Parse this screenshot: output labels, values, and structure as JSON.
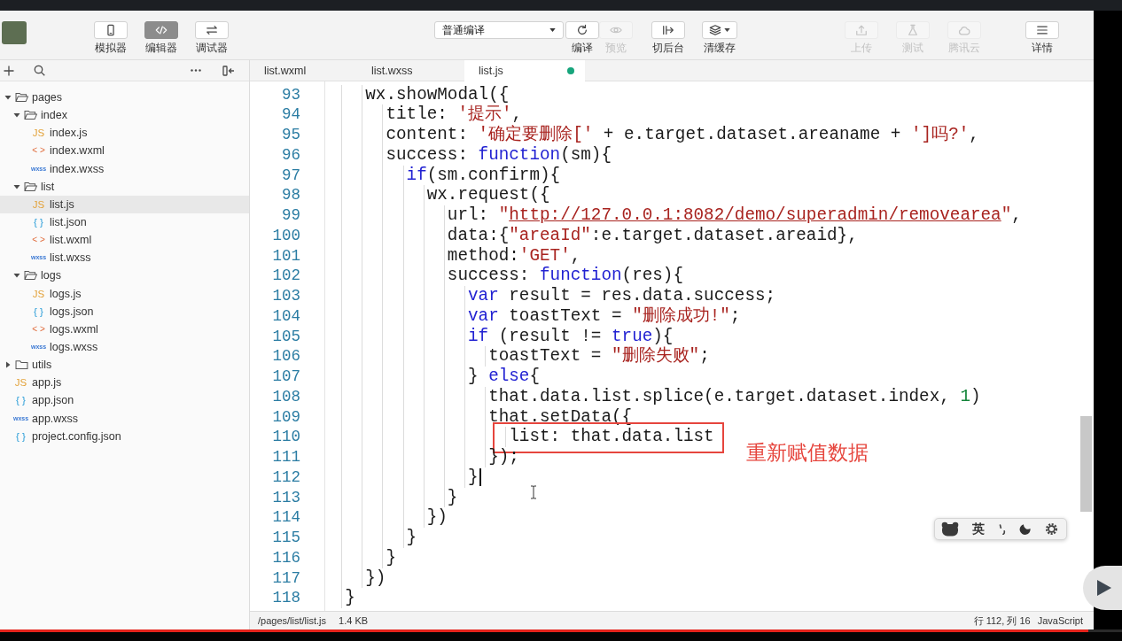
{
  "toolbar": {
    "views": [
      {
        "label": "模拟器",
        "kind": "simulator",
        "selected": false
      },
      {
        "label": "编辑器",
        "kind": "editor",
        "selected": true
      },
      {
        "label": "调试器",
        "kind": "debugger",
        "selected": false
      }
    ],
    "compile": {
      "mode": "普通编译",
      "buttons": [
        {
          "label": "编译",
          "kind": "compile",
          "disabled": false
        },
        {
          "label": "预览",
          "kind": "preview",
          "disabled": true
        }
      ]
    },
    "tools": [
      {
        "label": "切后台",
        "kind": "background",
        "disabled": false
      },
      {
        "label": "清缓存",
        "kind": "cache",
        "disabled": false
      }
    ],
    "services": [
      {
        "label": "上传",
        "kind": "upload",
        "disabled": true
      },
      {
        "label": "测试",
        "kind": "test",
        "disabled": true
      },
      {
        "label": "腾讯云",
        "kind": "cloud",
        "disabled": true
      }
    ],
    "details": {
      "label": "详情",
      "kind": "details",
      "disabled": false
    }
  },
  "sidebar": {
    "tree": [
      {
        "name": "pages",
        "kind": "folder",
        "expanded": true,
        "selected": false,
        "children": [
          {
            "name": "index",
            "kind": "folder",
            "expanded": true,
            "selected": false,
            "children": [
              {
                "name": "index.js",
                "kind": "js",
                "type_label": "JS",
                "selected": false
              },
              {
                "name": "index.wxml",
                "kind": "wxml",
                "type_label": "< >",
                "selected": false
              },
              {
                "name": "index.wxss",
                "kind": "wxss",
                "type_label": "wxss",
                "selected": false
              }
            ]
          },
          {
            "name": "list",
            "kind": "folder",
            "expanded": true,
            "selected": false,
            "children": [
              {
                "name": "list.js",
                "kind": "js",
                "type_label": "JS",
                "selected": true
              },
              {
                "name": "list.json",
                "kind": "json",
                "type_label": "{ }",
                "selected": false
              },
              {
                "name": "list.wxml",
                "kind": "wxml",
                "type_label": "< >",
                "selected": false
              },
              {
                "name": "list.wxss",
                "kind": "wxss",
                "type_label": "wxss",
                "selected": false
              }
            ]
          },
          {
            "name": "logs",
            "kind": "folder",
            "expanded": true,
            "selected": false,
            "children": [
              {
                "name": "logs.js",
                "kind": "js",
                "type_label": "JS",
                "selected": false
              },
              {
                "name": "logs.json",
                "kind": "json",
                "type_label": "{ }",
                "selected": false
              },
              {
                "name": "logs.wxml",
                "kind": "wxml",
                "type_label": "< >",
                "selected": false
              },
              {
                "name": "logs.wxss",
                "kind": "wxss",
                "type_label": "wxss",
                "selected": false
              }
            ]
          }
        ]
      },
      {
        "name": "utils",
        "kind": "folder",
        "expanded": false,
        "selected": false
      },
      {
        "name": "app.js",
        "kind": "js",
        "type_label": "JS",
        "selected": false
      },
      {
        "name": "app.json",
        "kind": "json",
        "type_label": "{ }",
        "selected": false
      },
      {
        "name": "app.wxss",
        "kind": "wxss",
        "type_label": "wxss",
        "selected": false
      },
      {
        "name": "project.config.json",
        "kind": "json",
        "type_label": "{ }",
        "selected": false
      }
    ]
  },
  "tabs": [
    {
      "label": "list.wxml",
      "selected": false,
      "modified": false
    },
    {
      "label": "list.wxss",
      "selected": false,
      "modified": false
    },
    {
      "label": "list.js",
      "selected": true,
      "modified": true
    }
  ],
  "editor": {
    "lines": [
      {
        "number": "93",
        "cursor": false,
        "highlighted": false,
        "code": [
          {
            "kind": "plain",
            "text": "    wx.showModal({"
          }
        ]
      },
      {
        "number": "94",
        "cursor": false,
        "highlighted": false,
        "code": [
          {
            "kind": "plain",
            "text": "      title: "
          },
          {
            "kind": "string",
            "text": "'提示'"
          },
          {
            "kind": "plain",
            "text": ","
          }
        ]
      },
      {
        "number": "95",
        "cursor": false,
        "highlighted": false,
        "code": [
          {
            "kind": "plain",
            "text": "      content: "
          },
          {
            "kind": "string",
            "text": "'确定要删除['"
          },
          {
            "kind": "plain",
            "text": " + e.target.dataset.areaname + "
          },
          {
            "kind": "string",
            "text": "']吗?'"
          },
          {
            "kind": "plain",
            "text": ","
          }
        ]
      },
      {
        "number": "96",
        "cursor": false,
        "highlighted": false,
        "code": [
          {
            "kind": "plain",
            "text": "      success: "
          },
          {
            "kind": "keyword",
            "text": "function"
          },
          {
            "kind": "plain",
            "text": "(sm){"
          }
        ]
      },
      {
        "number": "97",
        "cursor": false,
        "highlighted": false,
        "code": [
          {
            "kind": "keyword",
            "text": "        if"
          },
          {
            "kind": "plain",
            "text": "(sm.confirm){"
          }
        ]
      },
      {
        "number": "98",
        "cursor": false,
        "highlighted": false,
        "code": [
          {
            "kind": "plain",
            "text": "          wx.request({"
          }
        ]
      },
      {
        "number": "99",
        "cursor": false,
        "highlighted": false,
        "code": [
          {
            "kind": "plain",
            "text": "            url: "
          },
          {
            "kind": "string",
            "text": "\""
          },
          {
            "kind": "link",
            "text": "http://127.0.0.1:8082/demo/superadmin/removearea"
          },
          {
            "kind": "string",
            "text": "\""
          },
          {
            "kind": "plain",
            "text": ","
          }
        ]
      },
      {
        "number": "100",
        "cursor": false,
        "highlighted": false,
        "code": [
          {
            "kind": "plain",
            "text": "            data:{"
          },
          {
            "kind": "string",
            "text": "\"areaId\""
          },
          {
            "kind": "plain",
            "text": ":e.target.dataset.areaid},"
          }
        ]
      },
      {
        "number": "101",
        "cursor": false,
        "highlighted": false,
        "code": [
          {
            "kind": "plain",
            "text": "            method:"
          },
          {
            "kind": "string",
            "text": "'GET'"
          },
          {
            "kind": "plain",
            "text": ","
          }
        ]
      },
      {
        "number": "102",
        "cursor": false,
        "highlighted": false,
        "code": [
          {
            "kind": "plain",
            "text": "            success: "
          },
          {
            "kind": "keyword",
            "text": "function"
          },
          {
            "kind": "plain",
            "text": "(res){"
          }
        ]
      },
      {
        "number": "103",
        "cursor": false,
        "highlighted": false,
        "code": [
          {
            "kind": "keyword",
            "text": "              var"
          },
          {
            "kind": "plain",
            "text": " result = res.data.success;"
          }
        ]
      },
      {
        "number": "104",
        "cursor": false,
        "highlighted": false,
        "code": [
          {
            "kind": "keyword",
            "text": "              var"
          },
          {
            "kind": "plain",
            "text": " toastText = "
          },
          {
            "kind": "string",
            "text": "\"删除成功!\""
          },
          {
            "kind": "plain",
            "text": ";"
          }
        ]
      },
      {
        "number": "105",
        "cursor": false,
        "highlighted": false,
        "code": [
          {
            "kind": "keyword",
            "text": "              if"
          },
          {
            "kind": "plain",
            "text": " (result != "
          },
          {
            "kind": "keyword",
            "text": "true"
          },
          {
            "kind": "plain",
            "text": "){"
          }
        ]
      },
      {
        "number": "106",
        "cursor": false,
        "highlighted": false,
        "code": [
          {
            "kind": "plain",
            "text": "                toastText = "
          },
          {
            "kind": "string",
            "text": "\"删除失败\""
          },
          {
            "kind": "plain",
            "text": ";"
          }
        ]
      },
      {
        "number": "107",
        "cursor": false,
        "highlighted": false,
        "code": [
          {
            "kind": "plain",
            "text": "              } "
          },
          {
            "kind": "keyword",
            "text": "else"
          },
          {
            "kind": "plain",
            "text": "{"
          }
        ]
      },
      {
        "number": "108",
        "cursor": false,
        "highlighted": false,
        "code": [
          {
            "kind": "plain",
            "text": "                that.data.list.splice(e.target.dataset.index, "
          },
          {
            "kind": "number",
            "text": "1"
          },
          {
            "kind": "plain",
            "text": ")"
          }
        ]
      },
      {
        "number": "109",
        "cursor": false,
        "highlighted": false,
        "code": [
          {
            "kind": "plain",
            "text": "                that.setData({"
          }
        ]
      },
      {
        "number": "110",
        "cursor": false,
        "highlighted": true,
        "note": "重新赋值数据",
        "code": [
          {
            "kind": "plain",
            "text": "                  list: that.data.list"
          }
        ]
      },
      {
        "number": "111",
        "cursor": false,
        "highlighted": false,
        "code": [
          {
            "kind": "plain",
            "text": "                });"
          }
        ]
      },
      {
        "number": "112",
        "cursor": true,
        "highlighted": false,
        "code": [
          {
            "kind": "plain",
            "text": "              }"
          }
        ]
      },
      {
        "number": "113",
        "cursor": false,
        "highlighted": false,
        "code": [
          {
            "kind": "plain",
            "text": "            }"
          }
        ]
      },
      {
        "number": "114",
        "cursor": false,
        "highlighted": false,
        "code": [
          {
            "kind": "plain",
            "text": "          })"
          }
        ]
      },
      {
        "number": "115",
        "cursor": false,
        "highlighted": false,
        "code": [
          {
            "kind": "plain",
            "text": "        }"
          }
        ]
      },
      {
        "number": "116",
        "cursor": false,
        "highlighted": false,
        "code": [
          {
            "kind": "plain",
            "text": "      }"
          }
        ]
      },
      {
        "number": "117",
        "cursor": false,
        "highlighted": false,
        "code": [
          {
            "kind": "plain",
            "text": "    })"
          }
        ]
      },
      {
        "number": "118",
        "cursor": false,
        "highlighted": false,
        "code": [
          {
            "kind": "plain",
            "text": "  }"
          }
        ]
      }
    ]
  },
  "status_bar": {
    "path": "/pages/list/list.js",
    "size": "1.4 KB",
    "position": "行 112, 列 16",
    "language": "JavaScript"
  },
  "input_method": {
    "mode": "英"
  },
  "player": {
    "progress": {
      "level": 0.97
    }
  }
}
